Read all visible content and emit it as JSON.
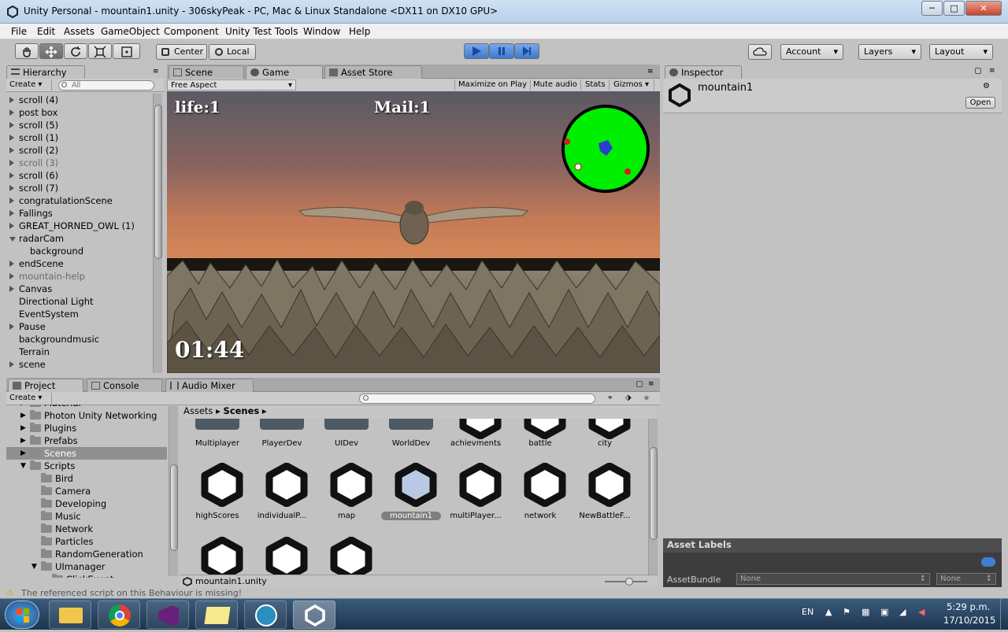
{
  "window": {
    "title": "Unity Personal - mountain1.unity - 306skyPeak - PC, Mac & Linux Standalone <DX11 on DX10 GPU>",
    "minimize": "─",
    "maximize": "□",
    "close": "✕"
  },
  "menu": [
    "File",
    "Edit",
    "Assets",
    "GameObject",
    "Component",
    "Unity Test Tools",
    "Window",
    "Help"
  ],
  "toolbar": {
    "pivot": "Center",
    "space": "Local",
    "account": "Account",
    "layers": "Layers",
    "layout": "Layout"
  },
  "hierarchy": {
    "tab": "Hierarchy",
    "create": "Create",
    "search_placeholder": "All",
    "items": [
      {
        "label": "scroll (4)",
        "expand": "closed",
        "indent": 0,
        "dim": false
      },
      {
        "label": "post box",
        "expand": "closed",
        "indent": 0,
        "dim": false
      },
      {
        "label": "scroll (5)",
        "expand": "closed",
        "indent": 0,
        "dim": false
      },
      {
        "label": "scroll (1)",
        "expand": "closed",
        "indent": 0,
        "dim": false
      },
      {
        "label": "scroll (2)",
        "expand": "closed",
        "indent": 0,
        "dim": false
      },
      {
        "label": "scroll (3)",
        "expand": "closed",
        "indent": 0,
        "dim": true
      },
      {
        "label": "scroll (6)",
        "expand": "closed",
        "indent": 0,
        "dim": false
      },
      {
        "label": "scroll (7)",
        "expand": "closed",
        "indent": 0,
        "dim": false
      },
      {
        "label": "congratulationScene",
        "expand": "closed",
        "indent": 0,
        "dim": false
      },
      {
        "label": "Fallings",
        "expand": "closed",
        "indent": 0,
        "dim": false
      },
      {
        "label": "GREAT_HORNED_OWL (1)",
        "expand": "closed",
        "indent": 0,
        "dim": false
      },
      {
        "label": "radarCam",
        "expand": "open",
        "indent": 0,
        "dim": false
      },
      {
        "label": "background",
        "expand": "none",
        "indent": 1,
        "dim": false
      },
      {
        "label": "endScene",
        "expand": "closed",
        "indent": 0,
        "dim": false
      },
      {
        "label": "mountain-help",
        "expand": "closed",
        "indent": 0,
        "dim": true
      },
      {
        "label": "Canvas",
        "expand": "closed",
        "indent": 0,
        "dim": false
      },
      {
        "label": "Directional Light",
        "expand": "none",
        "indent": 0,
        "dim": false
      },
      {
        "label": "EventSystem",
        "expand": "none",
        "indent": 0,
        "dim": false
      },
      {
        "label": "Pause",
        "expand": "closed",
        "indent": 0,
        "dim": false
      },
      {
        "label": "backgroundmusic",
        "expand": "none",
        "indent": 0,
        "dim": false
      },
      {
        "label": "Terrain",
        "expand": "none",
        "indent": 0,
        "dim": false
      },
      {
        "label": "scene",
        "expand": "closed",
        "indent": 0,
        "dim": false
      }
    ]
  },
  "game_panel": {
    "tabs": [
      "Scene",
      "Game",
      "Asset Store"
    ],
    "aspect": "Free Aspect",
    "options": [
      "Maximize on Play",
      "Mute audio",
      "Stats",
      "Gizmos"
    ],
    "hud": {
      "life": "life:1",
      "mail": "Mail:1",
      "timer": "01:44"
    }
  },
  "inspector": {
    "tab": "Inspector",
    "object_name": "mountain1",
    "open_button": "Open",
    "asset_labels": "Asset Labels",
    "asset_bundle_label": "AssetBundle",
    "bundle_value": "None",
    "variant_value": "None"
  },
  "project": {
    "tabs": [
      "Project",
      "Console",
      "Audio Mixer"
    ],
    "create": "Create",
    "breadcrumb": [
      "Assets",
      "Scenes"
    ],
    "folders": [
      {
        "label": "Material",
        "indent": 1,
        "expand": "closed"
      },
      {
        "label": "Photon Unity Networking",
        "indent": 1,
        "expand": "closed"
      },
      {
        "label": "Plugins",
        "indent": 1,
        "expand": "closed"
      },
      {
        "label": "Prefabs",
        "indent": 1,
        "expand": "closed"
      },
      {
        "label": "Scenes",
        "indent": 1,
        "expand": "closed",
        "selected": true
      },
      {
        "label": "Scripts",
        "indent": 1,
        "expand": "open"
      },
      {
        "label": "Bird",
        "indent": 2,
        "expand": "none"
      },
      {
        "label": "Camera",
        "indent": 2,
        "expand": "none"
      },
      {
        "label": "Developing",
        "indent": 2,
        "expand": "none"
      },
      {
        "label": "Music",
        "indent": 2,
        "expand": "none"
      },
      {
        "label": "Network",
        "indent": 2,
        "expand": "none"
      },
      {
        "label": "Particles",
        "indent": 2,
        "expand": "none"
      },
      {
        "label": "RandomGeneration",
        "indent": 2,
        "expand": "none"
      },
      {
        "label": "UImanager",
        "indent": 2,
        "expand": "open"
      },
      {
        "label": "ClickEvent",
        "indent": 3,
        "expand": "none"
      }
    ],
    "assets_row1": [
      "Multiplayer",
      "PlayerDev",
      "UIDev",
      "WorldDev",
      "achievments",
      "battle",
      "city"
    ],
    "assets_row2": [
      "highScores",
      "individualP...",
      "map",
      "mountain1",
      "multiPlayer...",
      "network",
      "NewBattleF..."
    ],
    "selected_file": "mountain1.unity"
  },
  "status": "The referenced script on this Behaviour is missing!",
  "taskbar": {
    "lang": "EN",
    "time": "5:29 p.m.",
    "date": "17/10/2015"
  }
}
